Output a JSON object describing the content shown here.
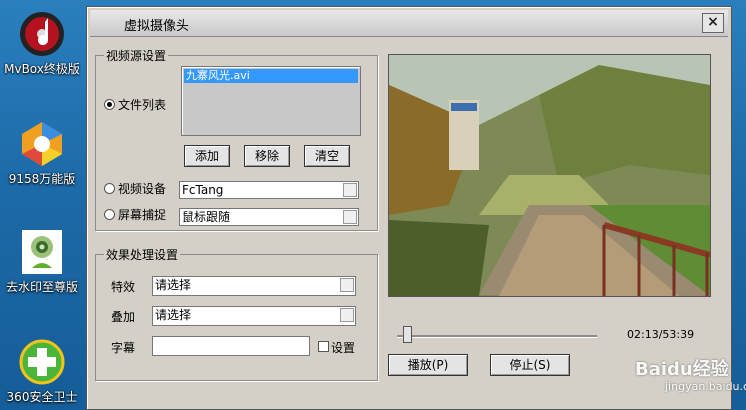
{
  "desktop": {
    "icons": [
      {
        "label": "MvBox终极版",
        "icon": "mvbox-icon",
        "color": "#b3121e"
      },
      {
        "label": "9158万能版",
        "icon": "9158-icon",
        "color": "#f0a020"
      },
      {
        "label": "去水印至尊版",
        "icon": "webcam-icon",
        "color": "#5fb030"
      },
      {
        "label": "360安全卫士",
        "icon": "360-shield-icon",
        "color": "#4bb43b"
      }
    ]
  },
  "window": {
    "title": "虚拟摄像头",
    "close_glyph": "×"
  },
  "video_source": {
    "group_label": "视频源设置",
    "file_list_label": "文件列表",
    "files": [
      "九寨风光.avi"
    ],
    "add_label": "添加",
    "remove_label": "移除",
    "clear_label": "清空",
    "device_label": "视频设备",
    "device_value": "FcTang",
    "capture_label": "屏幕捕捉",
    "capture_value": "鼠标跟随"
  },
  "effects": {
    "group_label": "效果处理设置",
    "effect_label": "特效",
    "effect_value": "请选择",
    "overlay_label": "叠加",
    "overlay_value": "请选择",
    "subtitle_label": "字幕",
    "subtitle_value": "",
    "settings_label": "设置"
  },
  "player": {
    "time": "02:13/53:39",
    "progress": 0.04,
    "play_label": "播放(P)",
    "stop_label": "停止(S)"
  },
  "watermark": {
    "text": "Baidu经验",
    "sub": "jingyan.baidu.com"
  }
}
